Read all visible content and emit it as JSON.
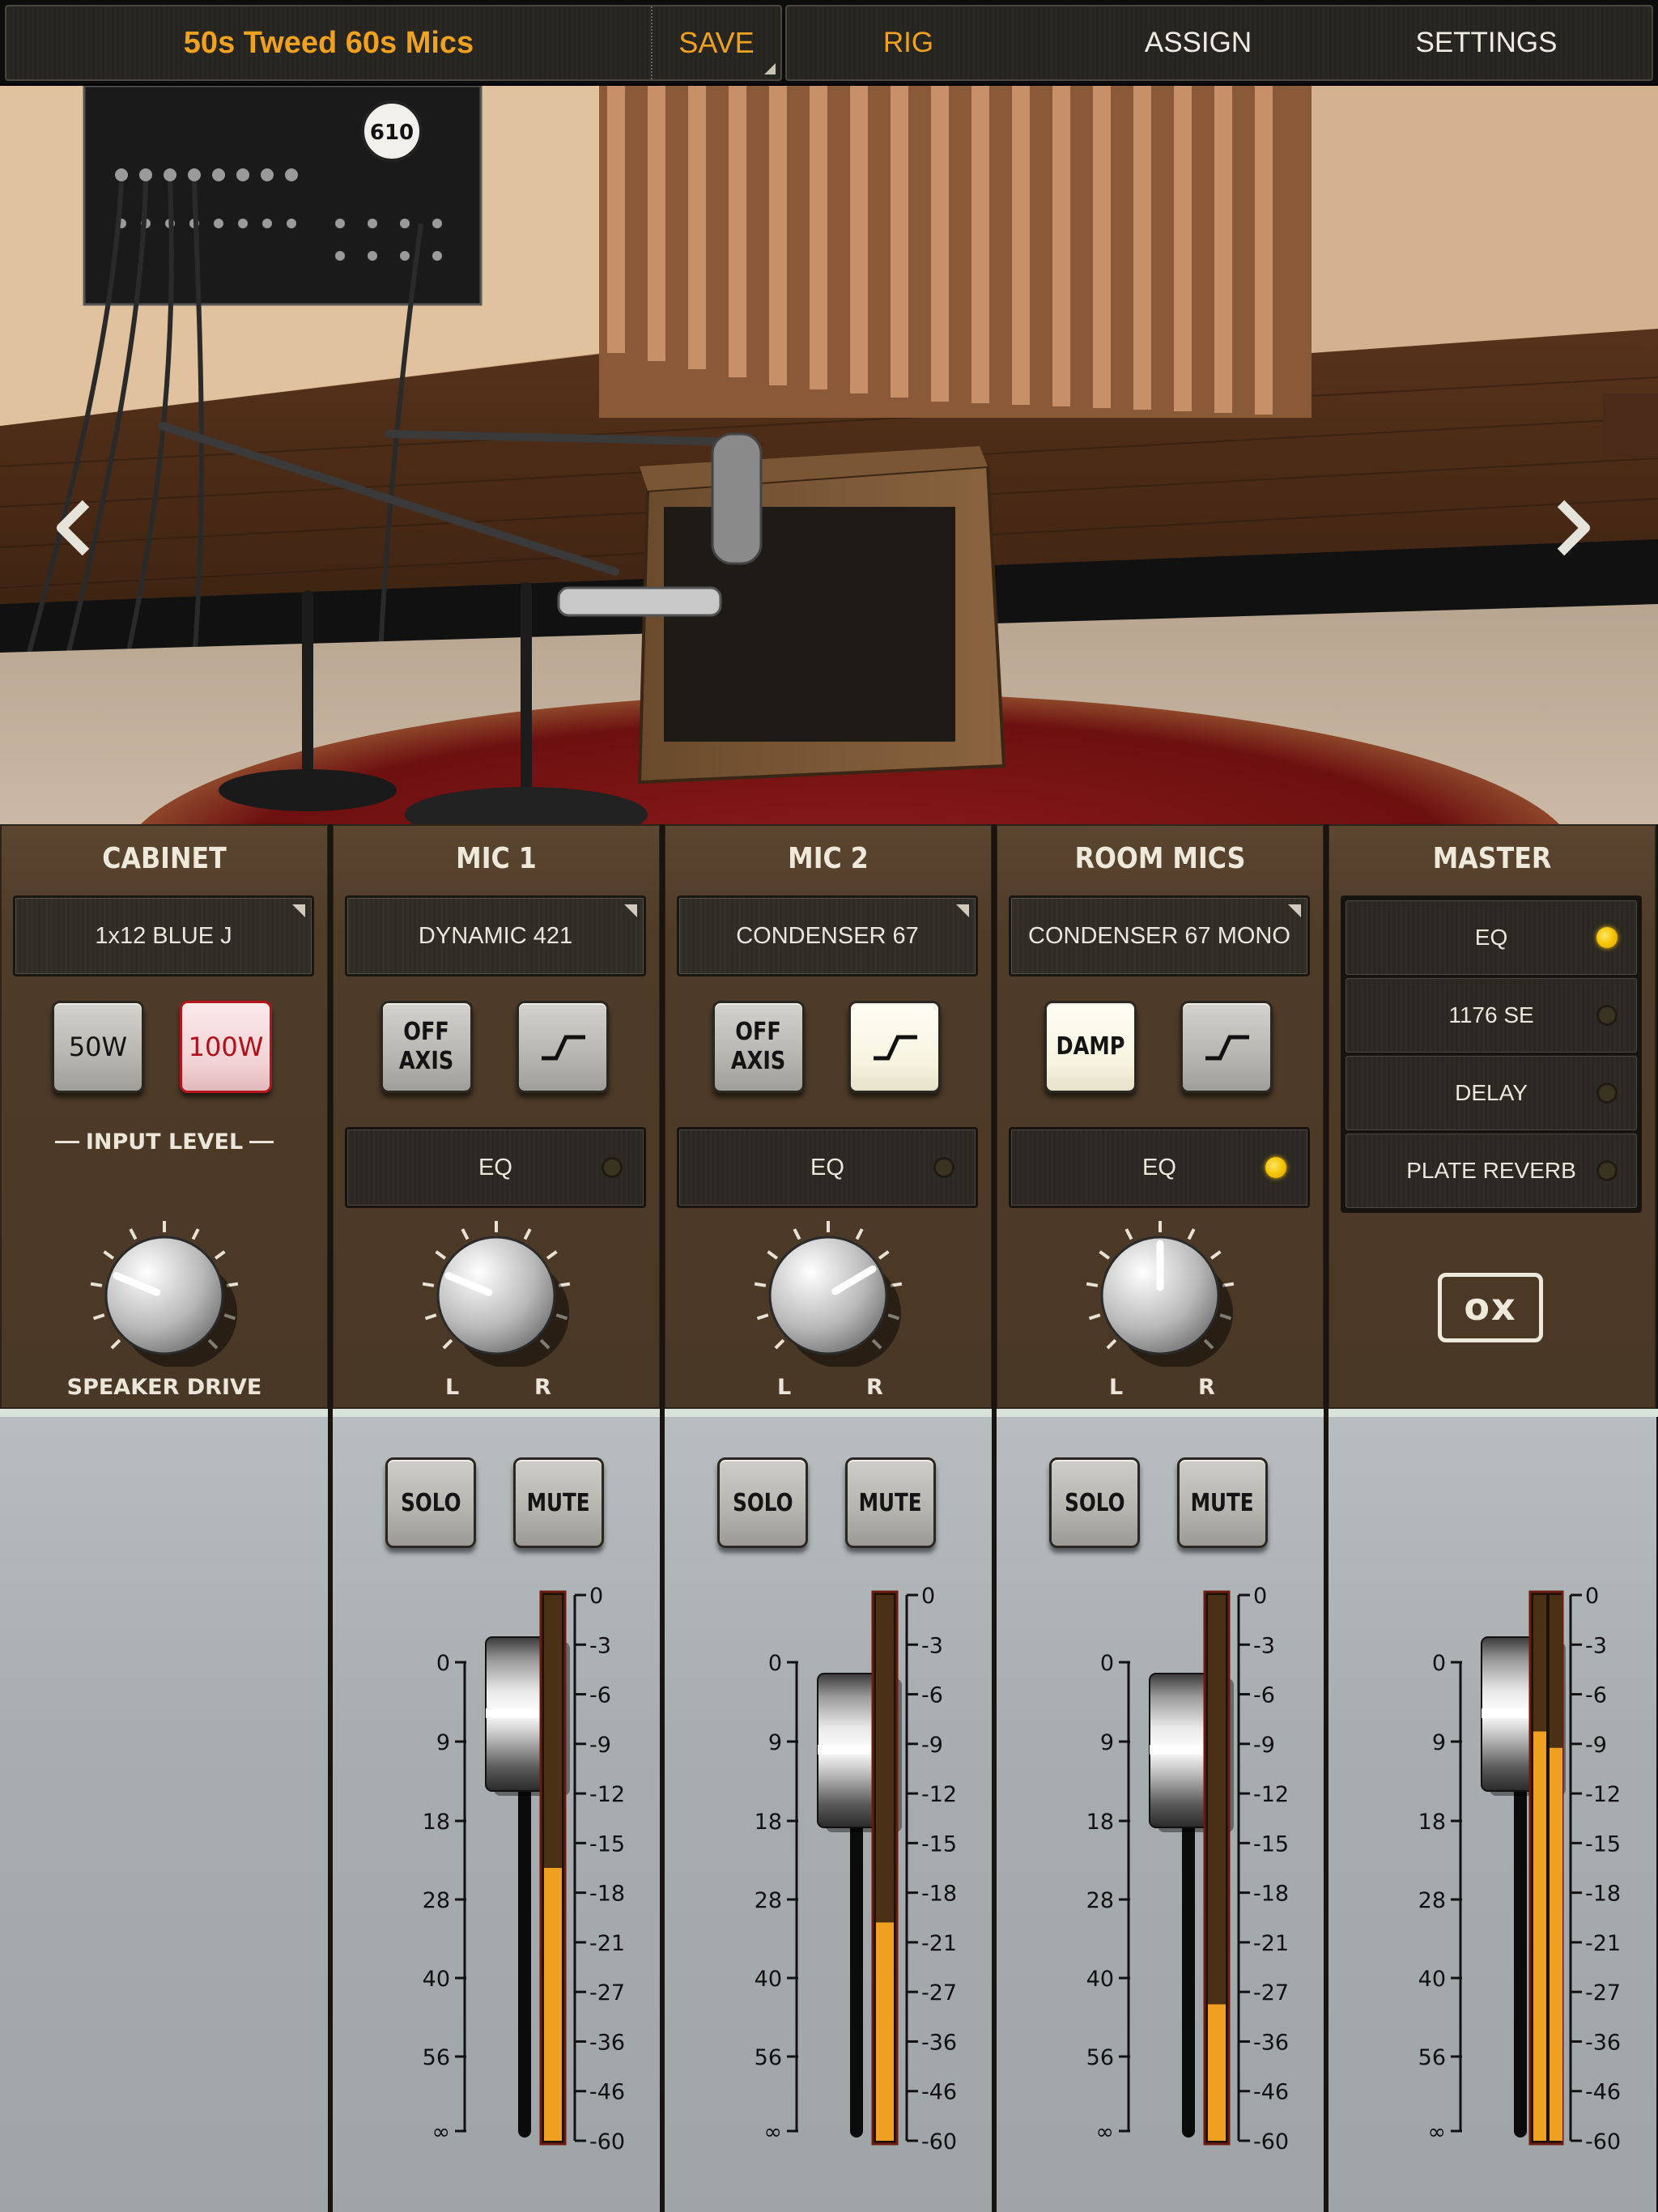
{
  "topbar": {
    "preset_name": "50s Tweed 60s Mics",
    "save_label": "SAVE",
    "tabs": [
      {
        "label": "RIG",
        "active": true
      },
      {
        "label": "ASSIGN",
        "active": false
      },
      {
        "label": "SETTINGS",
        "active": false
      }
    ]
  },
  "scene": {
    "panel_badge": "610",
    "prev_icon": "chevron-left-icon",
    "next_icon": "chevron-right-icon"
  },
  "cabinet": {
    "title": "CABINET",
    "model": "1x12 BLUE J",
    "btn_50w": "50W",
    "btn_100w": "100W",
    "selected_power": "100W",
    "input_level_label": "INPUT LEVEL",
    "knob_label": "SPEAKER DRIVE",
    "speaker_drive": 0.25
  },
  "mic1": {
    "title": "MIC 1",
    "model": "DYNAMIC 421",
    "btn_axis": "OFF AXIS",
    "btn_axis_l1": "OFF",
    "btn_axis_l2": "AXIS",
    "lowcut_on": false,
    "eq_label": "EQ",
    "eq_on": false,
    "pan_l": "L",
    "pan_r": "R",
    "pan": 0.25,
    "solo": "SOLO",
    "mute": "MUTE",
    "fader_db": "0",
    "meter_level": 0.5
  },
  "mic2": {
    "title": "MIC 2",
    "model": "CONDENSER 67",
    "btn_axis_l1": "OFF",
    "btn_axis_l2": "AXIS",
    "lowcut_on": true,
    "eq_label": "EQ",
    "eq_on": false,
    "pan_l": "L",
    "pan_r": "R",
    "pan": 0.72,
    "solo": "SOLO",
    "mute": "MUTE",
    "fader_db": "-6",
    "meter_level": 0.4
  },
  "room": {
    "title": "ROOM MICS",
    "model": "CONDENSER 67 MONO",
    "btn_damp": "DAMP",
    "damp_on": true,
    "lowcut_on": false,
    "eq_label": "EQ",
    "eq_on": true,
    "pan_l": "L",
    "pan_r": "R",
    "pan": 0.5,
    "solo": "SOLO",
    "mute": "MUTE",
    "fader_db": "-6",
    "meter_level": 0.25
  },
  "master": {
    "title": "MASTER",
    "fx": [
      {
        "label": "EQ",
        "on": true
      },
      {
        "label": "1176 SE",
        "on": false
      },
      {
        "label": "DELAY",
        "on": false
      },
      {
        "label": "PLATE REVERB",
        "on": false
      }
    ],
    "logo": "OX",
    "fader_db": "0",
    "meter_level_l": 0.75,
    "meter_level_r": 0.72
  },
  "fader_scale": [
    "0",
    "9",
    "18",
    "28",
    "40",
    "56",
    "∞"
  ],
  "meter_scale": [
    "0",
    "-3",
    "-6",
    "-9",
    "-12",
    "-15",
    "-18",
    "-21",
    "-27",
    "-36",
    "-46",
    "-60"
  ],
  "colors": {
    "accent": "#f0a21e",
    "led_on": "#f5c400",
    "meter": "#f0a020",
    "strip_brown": "#4e3b28",
    "mixer_grey": "#a8aeb0"
  }
}
